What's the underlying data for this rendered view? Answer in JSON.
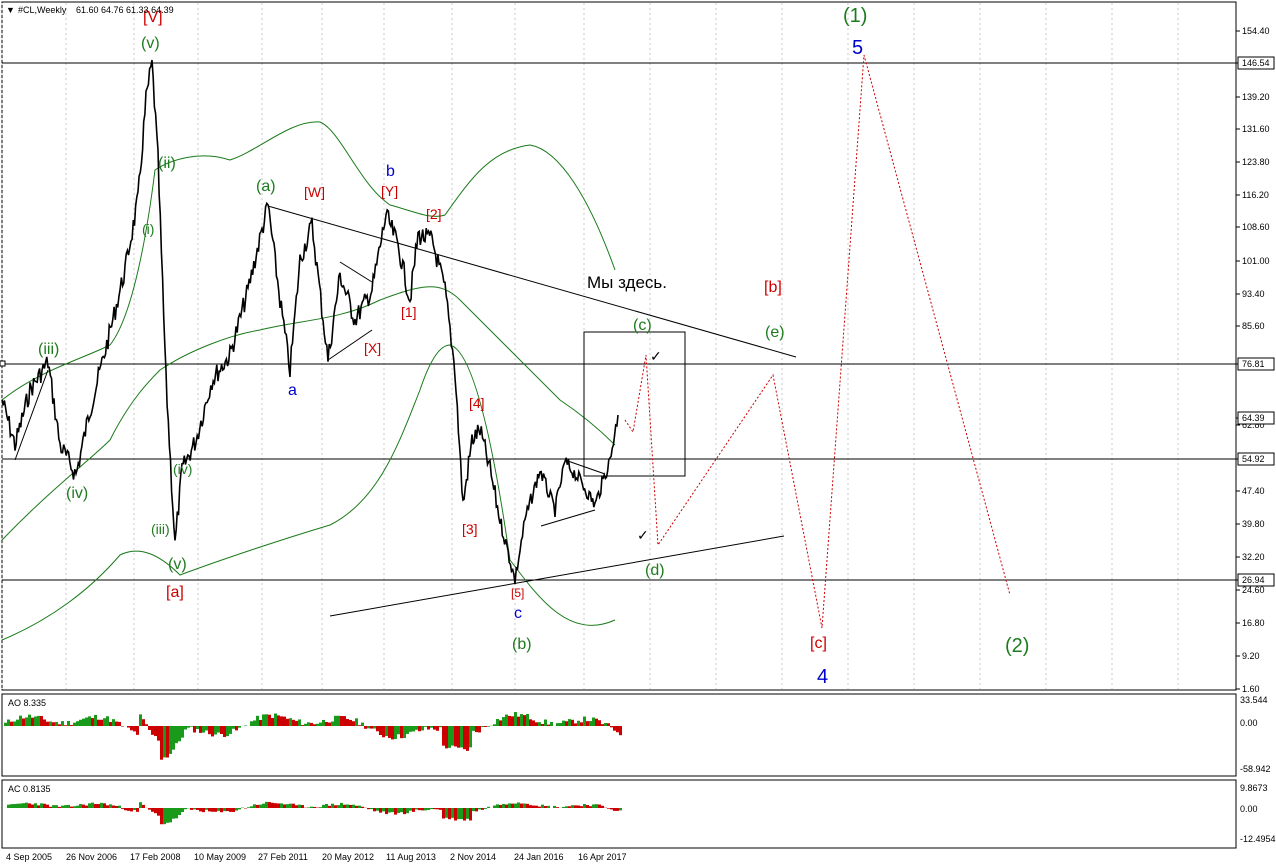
{
  "header": {
    "title": "#CL,Weekly",
    "ohlc": "61.60 64.76 61.33 64.39"
  },
  "price_axis": {
    "ticks": [
      "154.40",
      "146.54",
      "139.20",
      "131.60",
      "123.80",
      "116.20",
      "108.60",
      "101.00",
      "93.40",
      "85.60",
      "76.81",
      "62.80",
      "64.39",
      "54.92",
      "47.40",
      "39.80",
      "32.20",
      "26.94",
      "24.60",
      "16.80",
      "9.20",
      "1.60"
    ],
    "marked": [
      "146.54",
      "76.81",
      "64.39",
      "54.92",
      "26.94"
    ]
  },
  "time_axis": {
    "labels": [
      "4 Sep 2005",
      "26 Nov 2006",
      "17 Feb 2008",
      "10 May 2009",
      "27 Feb 2011",
      "20 May 2012",
      "11 Aug 2013",
      "2 Nov 2014",
      "24 Jan 2016",
      "16 Apr 2017"
    ]
  },
  "annotations": {
    "note": "Мы здесь.",
    "labels_red": [
      "[V]",
      "[W]",
      "[Y]",
      "[2]",
      "[1]",
      "[X]",
      "[4]",
      "[3]",
      "[5]",
      "[a]",
      "[b]",
      "[c]"
    ],
    "labels_green": [
      "(v)",
      "(ii)",
      "(i)",
      "(iii)",
      "(iv)",
      "(iii)",
      "(iv)",
      "(v)",
      "(a)",
      "(c)",
      "(e)",
      "(d)",
      "(b)",
      "(1)",
      "(2)"
    ],
    "labels_blue": [
      "b",
      "a",
      "c",
      "5",
      "4"
    ],
    "check_marks": [
      "✓",
      "✓"
    ]
  },
  "indicators": {
    "ao": {
      "title": "AO 8.335",
      "ticks": [
        "33.544",
        "0.00",
        "-58.942"
      ]
    },
    "ac": {
      "title": "AC 0.8135",
      "ticks": [
        "9.8673",
        "0.00",
        "-12.4954"
      ]
    }
  },
  "colors": {
    "red": "#cc0000",
    "green": "#1e7b1e",
    "blue": "#0000cc",
    "price": "#000000",
    "band": "#1a7a1a",
    "grid": "#c8c8c8"
  }
}
